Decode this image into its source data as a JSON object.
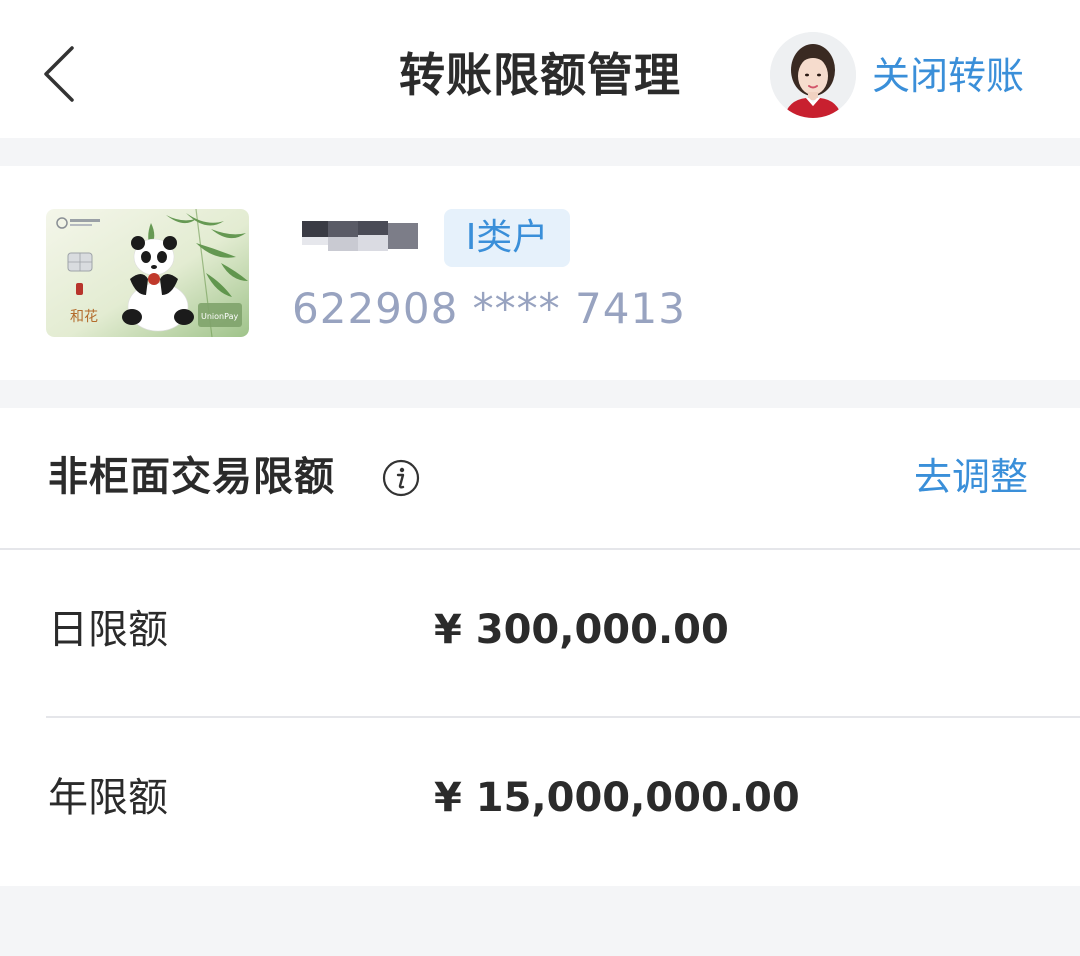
{
  "header": {
    "title": "转账限额管理",
    "close_label": "关闭转账",
    "back_icon": "chevron-left-icon",
    "avatar": "customer-service-avatar"
  },
  "card": {
    "account_type": "I类户",
    "number": "622908 **** 7413",
    "name_masked": true,
    "card_art": "panda-bamboo-card",
    "card_face_text": "UnionPay"
  },
  "limits": {
    "title": "非柜面交易限额",
    "info_icon": "info-icon",
    "adjust_label": "去调整",
    "rows": [
      {
        "label": "日限额",
        "value": "¥ 300,000.00"
      },
      {
        "label": "年限额",
        "value": "¥ 15,000,000.00"
      }
    ]
  },
  "colors": {
    "accent": "#3a8fd9",
    "text": "#2b2b2b",
    "card_number": "#98a3c0",
    "badge_bg": "#e6f1fb",
    "page_bg": "#f4f5f7"
  }
}
